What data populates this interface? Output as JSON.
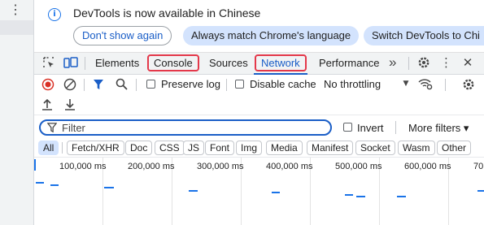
{
  "sidebar": {
    "menu_icon": "⋮"
  },
  "infobar": {
    "icon": "info-icon",
    "message": "DevTools is now available in Chinese",
    "buttons": [
      "Don't show again",
      "Always match Chrome's language",
      "Switch DevTools to Chi"
    ]
  },
  "tabs": {
    "items": [
      "Elements",
      "Console",
      "Sources",
      "Network",
      "Performance"
    ],
    "highlighted": [
      "Console",
      "Network"
    ],
    "selected": "Network",
    "more": "»",
    "icons": [
      "inspect-icon",
      "device-toolbar-icon",
      "settings-icon",
      "more-icon",
      "close-icon"
    ]
  },
  "toolbar": {
    "preserve_log": "Preserve log",
    "disable_cache": "Disable cache",
    "throttling": "No throttling",
    "icons": [
      "record-icon",
      "clear-icon",
      "filter-icon",
      "search-icon",
      "network-conditions-icon",
      "settings-icon",
      "import-icon",
      "export-icon"
    ]
  },
  "filter": {
    "placeholder": "Filter",
    "invert": "Invert",
    "more_filters": "More filters ▾"
  },
  "types": [
    "All",
    "Fetch/XHR",
    "Doc",
    "CSS",
    "JS",
    "Font",
    "Img",
    "Media",
    "Manifest",
    "Socket",
    "Wasm",
    "Other"
  ],
  "types_active": "All",
  "timeline": {
    "labels": [
      "100,000 ms",
      "200,000 ms",
      "300,000 ms",
      "400,000 ms",
      "500,000 ms",
      "600,000 ms",
      "70"
    ]
  },
  "colors": {
    "accent": "#1a5ec7",
    "highlight_box": "#e4384a",
    "active_chip": "#d3e3fd",
    "record": "#d93025"
  }
}
